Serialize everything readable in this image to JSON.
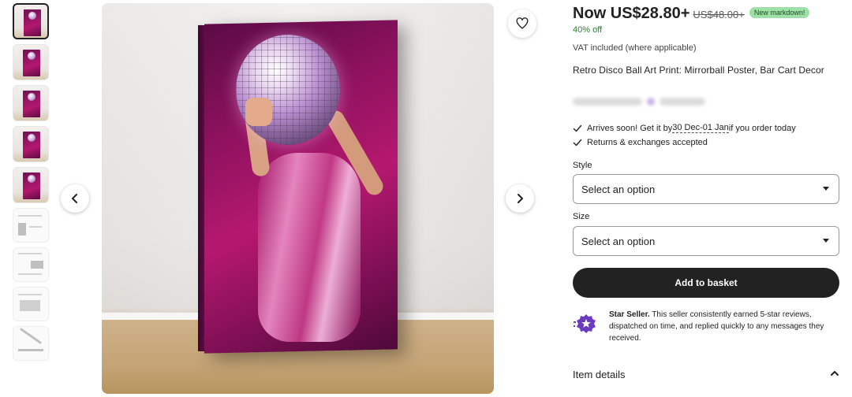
{
  "thumbnails": [
    {
      "kind": "image",
      "active": true
    },
    {
      "kind": "image",
      "active": false
    },
    {
      "kind": "image",
      "active": false
    },
    {
      "kind": "image",
      "active": false
    },
    {
      "kind": "image",
      "active": false
    },
    {
      "kind": "doc",
      "active": false
    },
    {
      "kind": "doc",
      "active": false
    },
    {
      "kind": "doc",
      "active": false
    },
    {
      "kind": "doc",
      "active": false
    }
  ],
  "pricing": {
    "now": "Now US$28.80+",
    "original": "US$48.00+",
    "badge": "New markdown!",
    "percent_off": "40% off",
    "vat_note": "VAT included (where applicable)"
  },
  "product": {
    "title": "Retro Disco Ball Art Print: Mirrorball Poster, Bar Cart Decor"
  },
  "shipping": {
    "arrives_prefix": "Arrives soon! Get it by ",
    "arrives_dates": "30 Dec-01 Jan",
    "arrives_suffix": " if you order today",
    "returns": "Returns & exchanges accepted"
  },
  "style_select": {
    "label": "Style",
    "value": "Select an option"
  },
  "size_select": {
    "label": "Size",
    "value": "Select an option"
  },
  "add_to_basket": "Add to basket",
  "star_seller": {
    "heading": "Star Seller.",
    "body": " This seller consistently earned 5-star reviews, dispatched on time, and replied quickly to any messages they received."
  },
  "item_details": "Item details",
  "colors": {
    "accent_purple": "#6a3bbf",
    "badge_green": "#9ee0a7",
    "off_green": "#2e7d32",
    "button_dark": "#222222"
  }
}
